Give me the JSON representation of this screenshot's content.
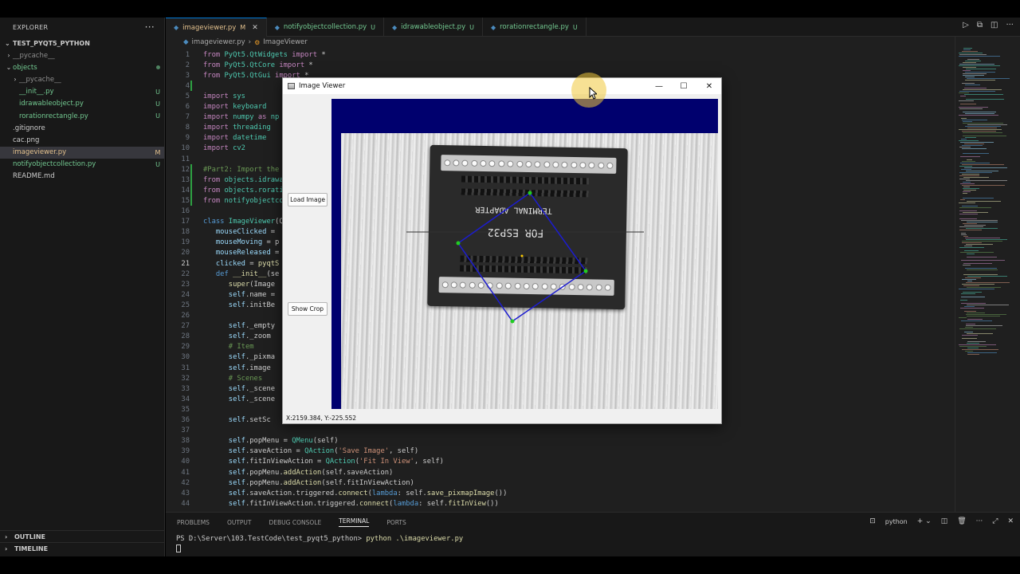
{
  "sidebar": {
    "title": "EXPLORER",
    "project": "TEST_PYQT5_PYTHON",
    "tree": [
      {
        "label": "__pycache__",
        "kind": "folder",
        "indent": 1,
        "status": "",
        "cls": "c-gray"
      },
      {
        "label": "objects",
        "kind": "folder-open",
        "indent": 1,
        "status": "dot",
        "cls": "c-green"
      },
      {
        "label": "__pycache__",
        "kind": "folder",
        "indent": 2,
        "status": "",
        "cls": "c-gray"
      },
      {
        "label": "__init__.py",
        "kind": "file",
        "indent": 2,
        "status": "U",
        "cls": "c-green"
      },
      {
        "label": "idrawableobject.py",
        "kind": "file",
        "indent": 2,
        "status": "U",
        "cls": "c-green"
      },
      {
        "label": "rorationrectangle.py",
        "kind": "file",
        "indent": 2,
        "status": "U",
        "cls": "c-green"
      },
      {
        "label": ".gitignore",
        "kind": "file",
        "indent": 1,
        "status": "",
        "cls": ""
      },
      {
        "label": "cac.png",
        "kind": "file",
        "indent": 1,
        "status": "",
        "cls": ""
      },
      {
        "label": "imageviewer.py",
        "kind": "file",
        "indent": 1,
        "status": "M",
        "cls": "c-yellow",
        "selected": true
      },
      {
        "label": "notifyobjectcollection.py",
        "kind": "file",
        "indent": 1,
        "status": "U",
        "cls": "c-green"
      },
      {
        "label": "README.md",
        "kind": "file",
        "indent": 1,
        "status": "",
        "cls": ""
      }
    ],
    "outline": "OUTLINE",
    "timeline": "TIMELINE"
  },
  "tabs": [
    {
      "label": "imageviewer.py",
      "status": "M",
      "active": true,
      "status_color": "#e2c08d"
    },
    {
      "label": "notifyobjectcollection.py",
      "status": "U",
      "active": false,
      "status_color": "#73c991"
    },
    {
      "label": "idrawableobject.py",
      "status": "U",
      "active": false,
      "status_color": "#73c991"
    },
    {
      "label": "rorationrectangle.py",
      "status": "U",
      "active": false,
      "status_color": "#73c991"
    }
  ],
  "breadcrumb": {
    "file": "imageviewer.py",
    "symbol": "ImageViewer"
  },
  "editor": {
    "current_line": 21,
    "lines": [
      [
        [
          "k",
          "from "
        ],
        [
          "m",
          "PyQt5.QtWidgets "
        ],
        [
          "k",
          "import "
        ],
        [
          "",
          "*"
        ]
      ],
      [
        [
          "k",
          "from "
        ],
        [
          "m",
          "PyQt5.QtCore "
        ],
        [
          "k",
          "import "
        ],
        [
          "",
          "*"
        ]
      ],
      [
        [
          "k",
          "from "
        ],
        [
          "m",
          "PyQt5.QtGui "
        ],
        [
          "k",
          "import "
        ],
        [
          "",
          "*"
        ]
      ],
      [],
      [
        [
          "k",
          "import "
        ],
        [
          "m",
          "sys"
        ]
      ],
      [
        [
          "k",
          "import "
        ],
        [
          "m",
          "keyboard"
        ]
      ],
      [
        [
          "k",
          "import "
        ],
        [
          "m",
          "numpy "
        ],
        [
          "k",
          "as "
        ],
        [
          "m",
          "np"
        ]
      ],
      [
        [
          "k",
          "import "
        ],
        [
          "m",
          "threading"
        ]
      ],
      [
        [
          "k",
          "import "
        ],
        [
          "m",
          "datetime"
        ]
      ],
      [
        [
          "k",
          "import "
        ],
        [
          "m",
          "cv2"
        ]
      ],
      [],
      [
        [
          "cm",
          "#Part2: Import the"
        ]
      ],
      [
        [
          "k",
          "from "
        ],
        [
          "m",
          "objects.idrawa"
        ]
      ],
      [
        [
          "k",
          "from "
        ],
        [
          "m",
          "objects.rorati"
        ]
      ],
      [
        [
          "k",
          "from "
        ],
        [
          "m",
          "notifyobjectco"
        ]
      ],
      [],
      [
        [
          "kb",
          "class "
        ],
        [
          "m",
          "ImageViewer"
        ],
        [
          "",
          "(Q"
        ]
      ],
      [
        [
          "",
          "   "
        ],
        [
          "v",
          "mouseClicked"
        ],
        [
          "",
          " ="
        ]
      ],
      [
        [
          "",
          "   "
        ],
        [
          "v",
          "mouseMoving"
        ],
        [
          "",
          " = p"
        ]
      ],
      [
        [
          "",
          "   "
        ],
        [
          "v",
          "mouseReleased"
        ],
        [
          "",
          " ="
        ]
      ],
      [
        [
          "",
          "   "
        ],
        [
          "v",
          "clicked"
        ],
        [
          "",
          " = "
        ],
        [
          "f",
          "pyqtS"
        ]
      ],
      [
        [
          "",
          "   "
        ],
        [
          "kb",
          "def "
        ],
        [
          "f",
          "__init__"
        ],
        [
          "",
          "(se"
        ]
      ],
      [
        [
          "",
          "      "
        ],
        [
          "f",
          "super"
        ],
        [
          "",
          "(Image"
        ]
      ],
      [
        [
          "",
          "      "
        ],
        [
          "v",
          "self"
        ],
        [
          "",
          ".name ="
        ]
      ],
      [
        [
          "",
          "      "
        ],
        [
          "v",
          "self"
        ],
        [
          "",
          ".initBe"
        ]
      ],
      [],
      [
        [
          "",
          "      "
        ],
        [
          "v",
          "self"
        ],
        [
          "",
          "._empty"
        ]
      ],
      [
        [
          "",
          "      "
        ],
        [
          "v",
          "self"
        ],
        [
          "",
          "._zoom"
        ]
      ],
      [
        [
          "",
          "      "
        ],
        [
          "cm",
          "# Item"
        ]
      ],
      [
        [
          "",
          "      "
        ],
        [
          "v",
          "self"
        ],
        [
          "",
          "._pixma"
        ]
      ],
      [
        [
          "",
          "      "
        ],
        [
          "v",
          "self"
        ],
        [
          "",
          ".image"
        ]
      ],
      [
        [
          "",
          "      "
        ],
        [
          "cm",
          "# Scenes"
        ]
      ],
      [
        [
          "",
          "      "
        ],
        [
          "v",
          "self"
        ],
        [
          "",
          "._scene"
        ]
      ],
      [
        [
          "",
          "      "
        ],
        [
          "v",
          "self"
        ],
        [
          "",
          "._scene"
        ]
      ],
      [],
      [
        [
          "",
          "      "
        ],
        [
          "v",
          "self"
        ],
        [
          "",
          ".setSc"
        ]
      ],
      [],
      [
        [
          "",
          "      "
        ],
        [
          "v",
          "self"
        ],
        [
          "",
          ".popMenu = "
        ],
        [
          "m",
          "QMenu"
        ],
        [
          "",
          "(self)"
        ]
      ],
      [
        [
          "",
          "      "
        ],
        [
          "v",
          "self"
        ],
        [
          "",
          ".saveAction = "
        ],
        [
          "m",
          "QAction"
        ],
        [
          "",
          "("
        ],
        [
          "s",
          "'Save Image'"
        ],
        [
          "",
          ", self)"
        ]
      ],
      [
        [
          "",
          "      "
        ],
        [
          "v",
          "self"
        ],
        [
          "",
          ".fitInViewAction = "
        ],
        [
          "m",
          "QAction"
        ],
        [
          "",
          "("
        ],
        [
          "s",
          "'Fit In View'"
        ],
        [
          "",
          ", self)"
        ]
      ],
      [
        [
          "",
          "      "
        ],
        [
          "v",
          "self"
        ],
        [
          "",
          ".popMenu."
        ],
        [
          "f",
          "addAction"
        ],
        [
          "",
          "(self.saveAction)"
        ]
      ],
      [
        [
          "",
          "      "
        ],
        [
          "v",
          "self"
        ],
        [
          "",
          ".popMenu."
        ],
        [
          "f",
          "addAction"
        ],
        [
          "",
          "(self.fitInViewAction)"
        ]
      ],
      [
        [
          "",
          "      "
        ],
        [
          "v",
          "self"
        ],
        [
          "",
          ".saveAction.triggered."
        ],
        [
          "f",
          "connect"
        ],
        [
          "",
          "("
        ],
        [
          "kb",
          "lambda"
        ],
        [
          "",
          ": self."
        ],
        [
          "f",
          "save_pixmapImage"
        ],
        [
          "",
          "())"
        ]
      ],
      [
        [
          "",
          "      "
        ],
        [
          "v",
          "self"
        ],
        [
          "",
          ".fitInViewAction.triggered."
        ],
        [
          "f",
          "connect"
        ],
        [
          "",
          "("
        ],
        [
          "kb",
          "lambda"
        ],
        [
          "",
          ": self."
        ],
        [
          "f",
          "fitInView"
        ],
        [
          "",
          "())"
        ]
      ]
    ]
  },
  "panel": {
    "tabs": [
      "PROBLEMS",
      "OUTPUT",
      "DEBUG CONSOLE",
      "TERMINAL",
      "PORTS"
    ],
    "active_tab": "TERMINAL",
    "terminal_label": "python",
    "prompt": "PS D:\\Server\\103.TestCode\\test_pyqt5_python>",
    "command": "python .\\imageviewer.py"
  },
  "window": {
    "title": "Image Viewer",
    "load_button": "Load Image",
    "crop_button": "Show Crop",
    "status": "X:2159.384, Y:-225.552",
    "board_text_1": "TERMINAL ADAPTER",
    "board_text_2": "FOR ESP32"
  },
  "colors": {
    "accent": "#0078d4",
    "modified": "#e2c08d",
    "untracked": "#73c991",
    "image_bg": "#00006e",
    "rect_outline": "#1c1cd0",
    "handle": "#22cc22"
  }
}
